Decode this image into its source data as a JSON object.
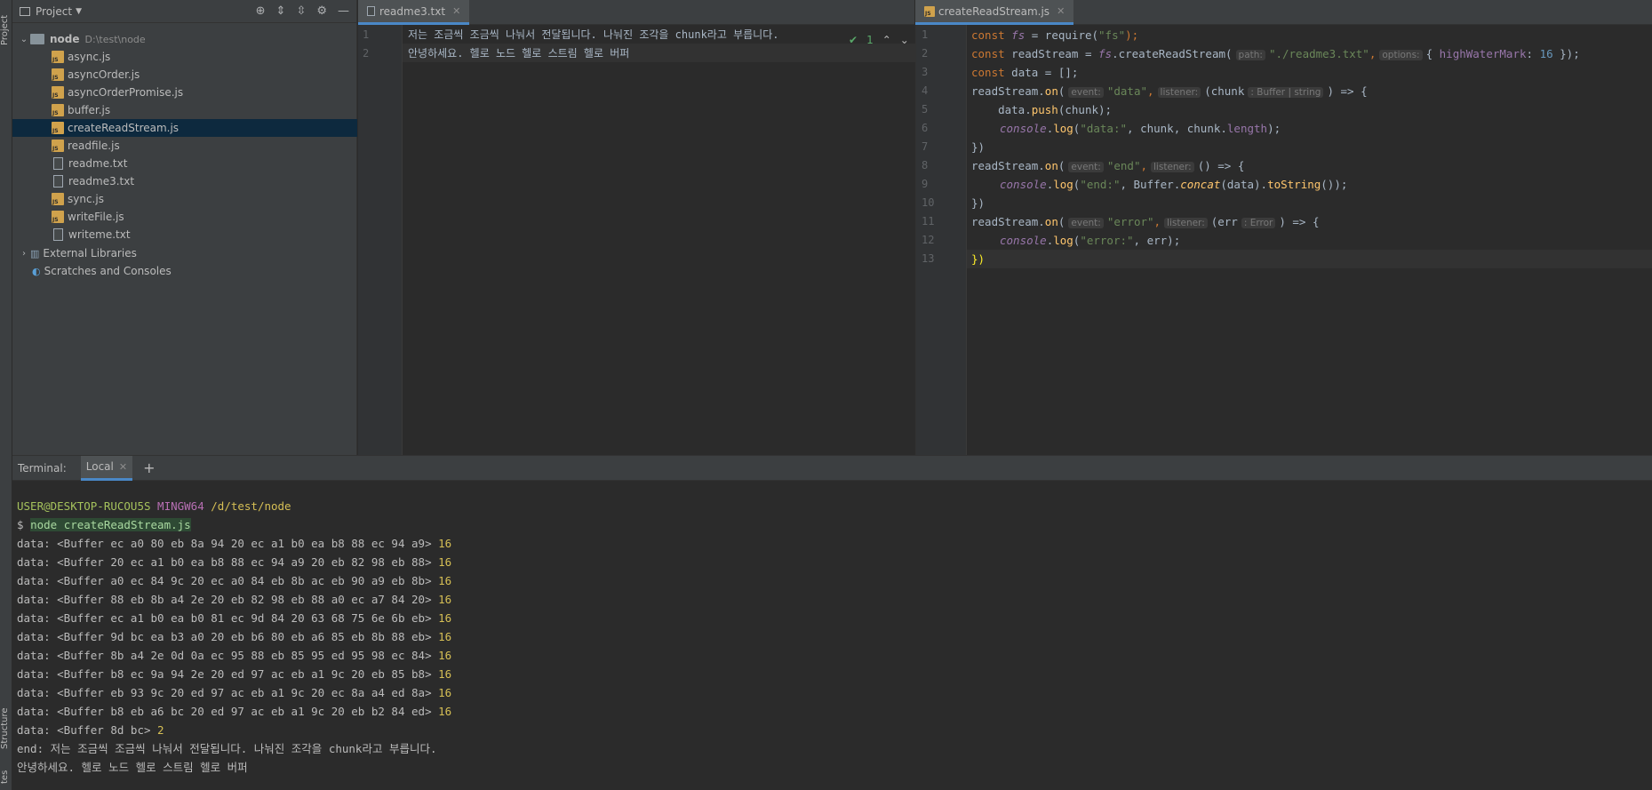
{
  "tool_strip": {
    "project_label": "Project",
    "structure_label": "Structure",
    "favorites_label": "tes"
  },
  "project_panel": {
    "title": "Project",
    "root": {
      "name": "node",
      "path": "D:\\test\\node"
    },
    "files": [
      {
        "name": "async.js",
        "type": "js"
      },
      {
        "name": "asyncOrder.js",
        "type": "js"
      },
      {
        "name": "asyncOrderPromise.js",
        "type": "js"
      },
      {
        "name": "buffer.js",
        "type": "js"
      },
      {
        "name": "createReadStream.js",
        "type": "js",
        "selected": true
      },
      {
        "name": "readfile.js",
        "type": "js"
      },
      {
        "name": "readme.txt",
        "type": "txt"
      },
      {
        "name": "readme3.txt",
        "type": "txt"
      },
      {
        "name": "sync.js",
        "type": "js"
      },
      {
        "name": "writeFile.js",
        "type": "js"
      },
      {
        "name": "writeme.txt",
        "type": "txt"
      }
    ],
    "external_libraries": "External Libraries",
    "scratches": "Scratches and Consoles"
  },
  "editor_left": {
    "tab": "readme3.txt",
    "lines": [
      "저는 조금씩 조금씩 나눠서 전달됩니다. 나눠진 조각을 chunk라고 부릅니다.",
      "안녕하세요. 헬로 노드 헬로 스트림 헬로 버퍼"
    ],
    "inspection_count": "1"
  },
  "editor_right": {
    "tab": "createReadStream.js",
    "line_numbers": [
      "1",
      "2",
      "3",
      "4",
      "5",
      "6",
      "7",
      "8",
      "9",
      "10",
      "11",
      "12",
      "13"
    ]
  },
  "terminal": {
    "label": "Terminal:",
    "tab": "Local",
    "prompt_user": "USER@DESKTOP-RUCOU5S",
    "prompt_env": "MINGW64",
    "prompt_path": "/d/test/node",
    "command": "node createReadStream.js",
    "data_lines": [
      {
        "buf": "data: <Buffer ec a0 80 eb 8a 94 20 ec a1 b0 ea b8 88 ec 94 a9>",
        "len": "16"
      },
      {
        "buf": "data: <Buffer 20 ec a1 b0 ea b8 88 ec 94 a9 20 eb 82 98 eb 88>",
        "len": "16"
      },
      {
        "buf": "data: <Buffer a0 ec 84 9c 20 ec a0 84 eb 8b ac eb 90 a9 eb 8b>",
        "len": "16"
      },
      {
        "buf": "data: <Buffer 88 eb 8b a4 2e 20 eb 82 98 eb 88 a0 ec a7 84 20>",
        "len": "16"
      },
      {
        "buf": "data: <Buffer ec a1 b0 ea b0 81 ec 9d 84 20 63 68 75 6e 6b eb>",
        "len": "16"
      },
      {
        "buf": "data: <Buffer 9d bc ea b3 a0 20 eb b6 80 eb a6 85 eb 8b 88 eb>",
        "len": "16"
      },
      {
        "buf": "data: <Buffer 8b a4 2e 0d 0a ec 95 88 eb 85 95 ed 95 98 ec 84>",
        "len": "16"
      },
      {
        "buf": "data: <Buffer b8 ec 9a 94 2e 20 ed 97 ac eb a1 9c 20 eb 85 b8>",
        "len": "16"
      },
      {
        "buf": "data: <Buffer eb 93 9c 20 ed 97 ac eb a1 9c 20 ec 8a a4 ed 8a>",
        "len": "16"
      },
      {
        "buf": "data: <Buffer b8 eb a6 bc 20 ed 97 ac eb a1 9c 20 eb b2 84 ed>",
        "len": "16"
      },
      {
        "buf": "data: <Buffer 8d bc>",
        "len": "2"
      }
    ],
    "end_line_1": "end: 저는 조금씩 조금씩 나눠서 전달됩니다. 나눠진 조각을 chunk라고 부릅니다.",
    "end_line_2": "안녕하세요. 헬로 노드 헬로 스트림 헬로 버퍼"
  },
  "code": {
    "l1_const": "const",
    "l1_var": "fs",
    "l1_eq": " = require(",
    "l1_str": "\"fs\"",
    "l1_end": ");",
    "l2_const": "const",
    "l2_var": " readStream = ",
    "l2_fs": "fs",
    "l2_call": ".createReadStream(",
    "l2_hint1": "path:",
    "l2_str": "\"./readme3.txt\"",
    "l2_comma": ",",
    "l2_hint2": "options:",
    "l2_obj1": "{ ",
    "l2_key": "highWaterMark",
    "l2_colon": ": ",
    "l2_num": "16",
    "l2_obj2": " });",
    "l3_const": "const",
    "l3_rest": " data = [];",
    "l4_a": "readStream.",
    "l4_on": "on",
    "l4_b": "(",
    "l4_hint1": "event:",
    "l4_str": "\"data\"",
    "l4_c": ",",
    "l4_hint2": "listener:",
    "l4_d": "(chunk",
    "l4_hint3": ": Buffer | string",
    "l4_e": ") => {",
    "l5_a": "    data.",
    "l5_push": "push",
    "l5_b": "(chunk);",
    "l6_console": "console",
    "l6_dot": ".",
    "l6_log": "log",
    "l6_b": "(",
    "l6_str": "\"data:\"",
    "l6_c": ", chunk, chunk.",
    "l6_len": "length",
    "l6_d": ");",
    "l7": "})",
    "l8_a": "readStream.",
    "l8_on": "on",
    "l8_b": "(",
    "l8_hint1": "event:",
    "l8_str": "\"end\"",
    "l8_c": ",",
    "l8_hint2": "listener:",
    "l8_d": "() => {",
    "l9_console": "console",
    "l9_dot": ".",
    "l9_log": "log",
    "l9_b": "(",
    "l9_str": "\"end:\"",
    "l9_c": ", Buffer.",
    "l9_concat": "concat",
    "l9_d": "(data).",
    "l9_ts": "toString",
    "l9_e": "());",
    "l10": "})",
    "l11_a": "readStream.",
    "l11_on": "on",
    "l11_b": "(",
    "l11_hint1": "event:",
    "l11_str": "\"error\"",
    "l11_c": ",",
    "l11_hint2": "listener:",
    "l11_d": "(err",
    "l11_hint3": ": Error",
    "l11_e": ") => {",
    "l12_console": "console",
    "l12_dot": ".",
    "l12_log": "log",
    "l12_b": "(",
    "l12_str": "\"error:\"",
    "l12_c": ", err);",
    "l13": "})"
  }
}
